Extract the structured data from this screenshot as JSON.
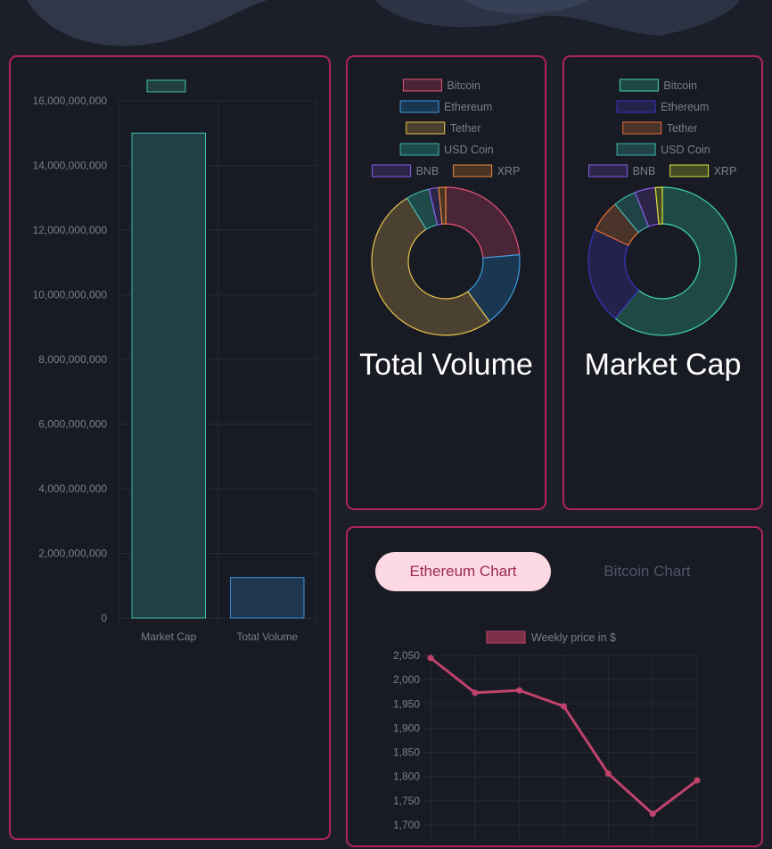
{
  "colors": {
    "border": "#b0245b",
    "background": "#1c1f29",
    "tab_active_bg": "#fdd9e3",
    "tab_active_text": "#9b2857"
  },
  "bar_card": {
    "chart_data": {
      "type": "bar",
      "categories": [
        "Market Cap",
        "Total Volume"
      ],
      "values": [
        15000000000,
        1250000000
      ],
      "ylim": [
        0,
        16000000000
      ],
      "yticks": [
        "0",
        "2,000,000,000",
        "4,000,000,000",
        "6,000,000,000",
        "8,000,000,000",
        "10,000,000,000",
        "12,000,000,000",
        "14,000,000,000",
        "16,000,000,000"
      ],
      "bar_colors": [
        "#3dbfb0",
        "#3a8fd6"
      ],
      "legend_label": "",
      "grid": true
    }
  },
  "volume_card": {
    "title": "Total Volume",
    "chart_data": {
      "type": "pie",
      "labels": [
        "Bitcoin",
        "Ethereum",
        "Tether",
        "USD Coin",
        "BNB",
        "XRP"
      ],
      "values": [
        23,
        16,
        50,
        5,
        2,
        1.5
      ],
      "colors": [
        "#e8557a",
        "#3b9ae0",
        "#e8c34a",
        "#3fb6b0",
        "#8a5cf0",
        "#e88a3a"
      ],
      "fills": [
        "#4a2535",
        "#1b3650",
        "#4a4131",
        "#1f4a4a",
        "#2c2548",
        "#4a3425"
      ]
    }
  },
  "cap_card": {
    "title": "Market Cap",
    "chart_data": {
      "type": "pie",
      "labels": [
        "Bitcoin",
        "Ethereum",
        "Tether",
        "USD Coin",
        "BNB",
        "XRP"
      ],
      "values": [
        61,
        21,
        7,
        5,
        4.5,
        1.5
      ],
      "colors": [
        "#3dd6a9",
        "#3634c4",
        "#e8703a",
        "#3fb6b0",
        "#8a5cf0",
        "#d6e03a"
      ],
      "fills": [
        "#1f4a44",
        "#23224a",
        "#4a3328",
        "#1f4346",
        "#2c2548",
        "#434a25"
      ]
    }
  },
  "line_card": {
    "tabs": [
      "Ethereum Chart",
      "Bitcoin Chart"
    ],
    "chart_data": {
      "type": "line",
      "series": [
        {
          "name": "Weekly price in $",
          "values": [
            2045,
            1973,
            1978,
            1945,
            1806,
            1723,
            1792
          ]
        }
      ],
      "yticks": [
        2050,
        2000,
        1950,
        1900,
        1850,
        1800,
        1750,
        1700
      ],
      "ylim": [
        1700,
        2050
      ],
      "color": "#c0436b",
      "grid": true
    }
  }
}
